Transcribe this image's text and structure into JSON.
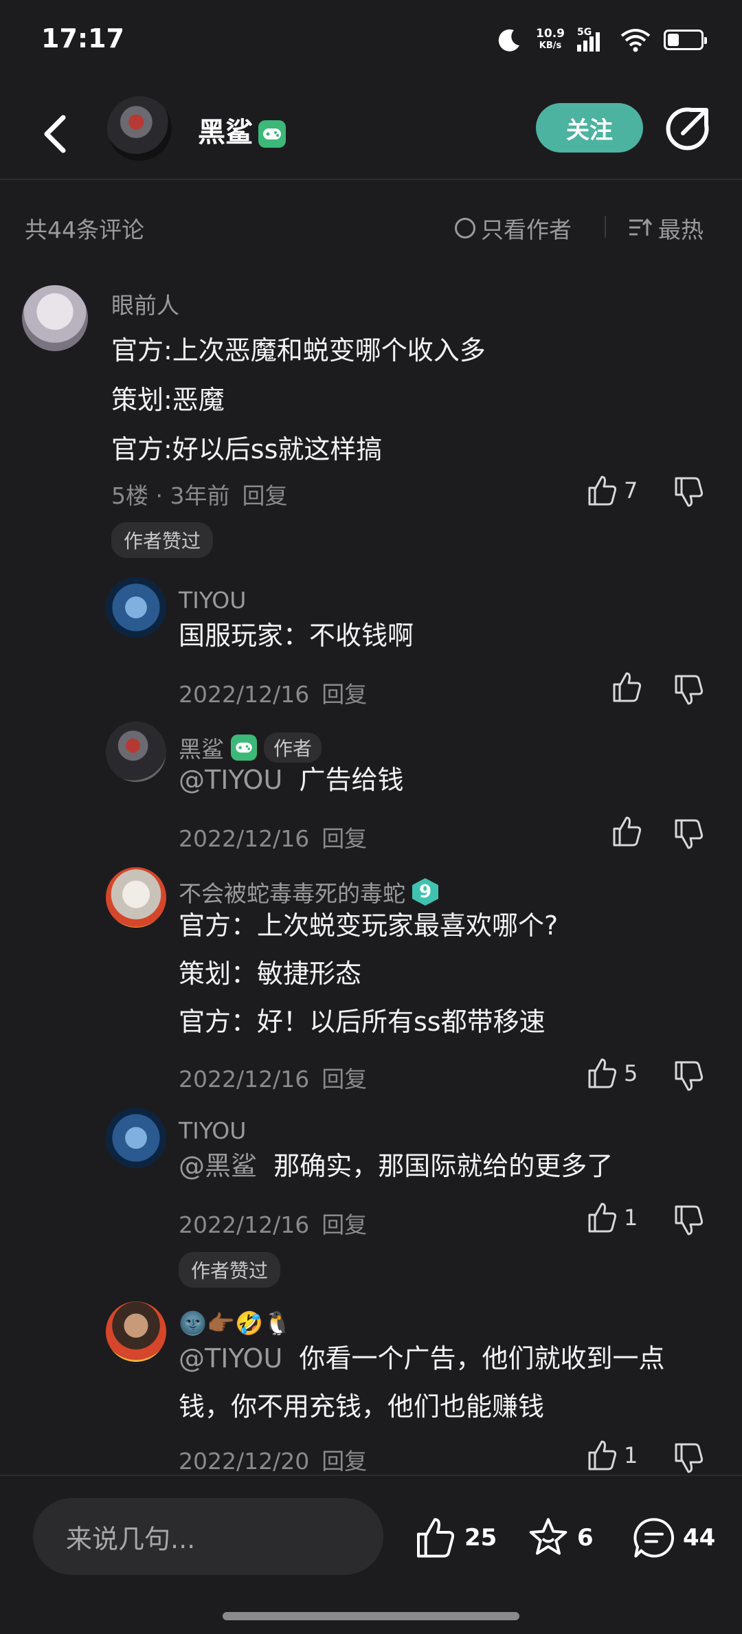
{
  "status": {
    "time": "17:17",
    "net_speed": "10.9",
    "net_unit": "KB/s",
    "network": "5G",
    "battery_level": 0.35
  },
  "header": {
    "name": "黑鲨",
    "follow": "关注"
  },
  "toolbar": {
    "count": "共44条评论",
    "author_only": "只看作者",
    "sort": "最热"
  },
  "main_comment": {
    "user": "眼前人",
    "lines": [
      "官方:上次恶魔和蜕变哪个收入多",
      "策划:恶魔",
      "官方:好以后ss就这样搞"
    ],
    "meta": "5楼 · 3年前",
    "reply": "回复",
    "likes": "7",
    "tag": "作者赞过"
  },
  "replies": [
    {
      "user": "TIYOU",
      "text": "国服玩家：不收钱啊",
      "date": "2022/12/16",
      "reply": "回复"
    },
    {
      "user": "黑鲨",
      "author_tag": "作者",
      "mention": "@TIYOU",
      "text": "广告给钱",
      "date": "2022/12/16",
      "reply": "回复"
    },
    {
      "user": "不会被蛇毒毒死的毒蛇",
      "level": "9",
      "lines": [
        "官方：上次蜕变玩家最喜欢哪个?",
        "策划：敏捷形态",
        "官方：好！以后所有ss都带移速"
      ],
      "date": "2022/12/16",
      "reply": "回复",
      "likes": "5"
    },
    {
      "user": "TIYOU",
      "mention": "@黑鲨",
      "text": "那确实，那国际就给的更多了",
      "date": "2022/12/16",
      "reply": "回复",
      "likes": "1",
      "tag": "作者赞过"
    },
    {
      "user": "🌚👉🏾🤣🐧",
      "mention": "@TIYOU",
      "text": "你看一个广告，他们就收到一点",
      "text2": "钱，你不用充钱，他们也能赚钱",
      "date": "2022/12/20",
      "reply": "回复",
      "likes": "1"
    }
  ],
  "bottom": {
    "placeholder": "来说几句...",
    "likes": "25",
    "favorites": "6",
    "comments": "44"
  }
}
